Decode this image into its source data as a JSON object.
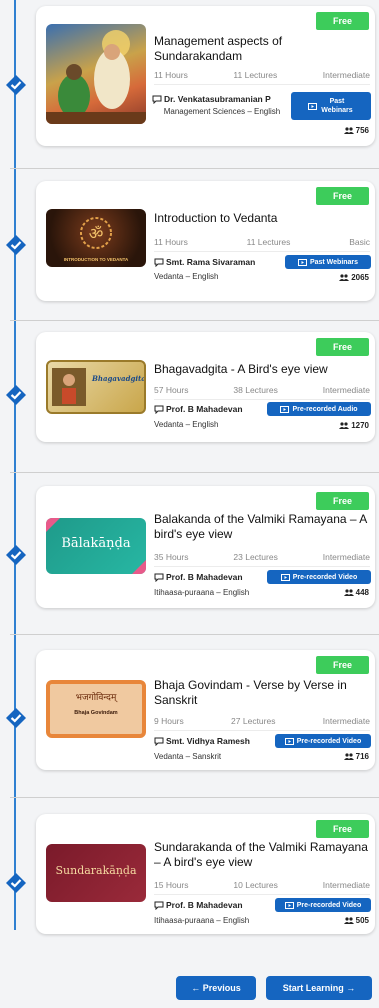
{
  "courses": [
    {
      "badge": "Free",
      "title": "Management aspects of Sundarakandam",
      "hours": "11 Hours",
      "lectures": "11 Lectures",
      "level": "Intermediate",
      "author": "Dr. Venkatasubramanian P",
      "category": "Management Sciences – English",
      "type": "Past Webinars",
      "count": "756",
      "thumb_text": ""
    },
    {
      "badge": "Free",
      "title": "Introduction to Vedanta",
      "hours": "11 Hours",
      "lectures": "11 Lectures",
      "level": "Basic",
      "author": "Smt. Rama Sivaraman",
      "category": "Vedanta – English",
      "type": "Past Webinars",
      "count": "2065",
      "thumb_text": "INTRODUCTION TO VEDANTA"
    },
    {
      "badge": "Free",
      "title": "Bhagavadgita - A Bird's eye view",
      "hours": "57 Hours",
      "lectures": "38 Lectures",
      "level": "Intermediate",
      "author": "Prof. B Mahadevan",
      "category": "Vedanta – English",
      "type": "Pre-recorded Audio",
      "count": "1270",
      "thumb_text": "Bhagavadgita"
    },
    {
      "badge": "Free",
      "title": "Balakanda of the Valmiki Ramayana – A bird's eye view",
      "hours": "35 Hours",
      "lectures": "23 Lectures",
      "level": "Intermediate",
      "author": "Prof. B Mahadevan",
      "category": "Itihaasa-puraana – English",
      "type": "Pre-recorded Video",
      "count": "448",
      "thumb_text": "Bālakāṇḍa"
    },
    {
      "badge": "Free",
      "title": "Bhaja Govindam - Verse by Verse in Sanskrit",
      "hours": "9 Hours",
      "lectures": "27 Lectures",
      "level": "Intermediate",
      "author": "Smt. Vidhya Ramesh",
      "category": "Vedanta – Sanskrit",
      "type": "Pre-recorded Video",
      "count": "716",
      "thumb_text": "भजगोविन्दम्"
    },
    {
      "badge": "Free",
      "title": "Sundarakanda of the Valmiki Ramayana – A bird's eye view",
      "hours": "15 Hours",
      "lectures": "10 Lectures",
      "level": "Intermediate",
      "author": "Prof. B Mahadevan",
      "category": "Itihaasa-puraana – English",
      "type": "Pre-recorded Video",
      "count": "505",
      "thumb_text": "Sundarakāṇḍa"
    }
  ],
  "thumb_sub": {
    "c4": "Bhaja Govindam"
  },
  "nav": {
    "previous": "← Previous",
    "start": "Start Learning →"
  },
  "colors": {
    "accent": "#1565c0",
    "badge": "#3dcc5b",
    "timeline": "#2f80d1"
  }
}
